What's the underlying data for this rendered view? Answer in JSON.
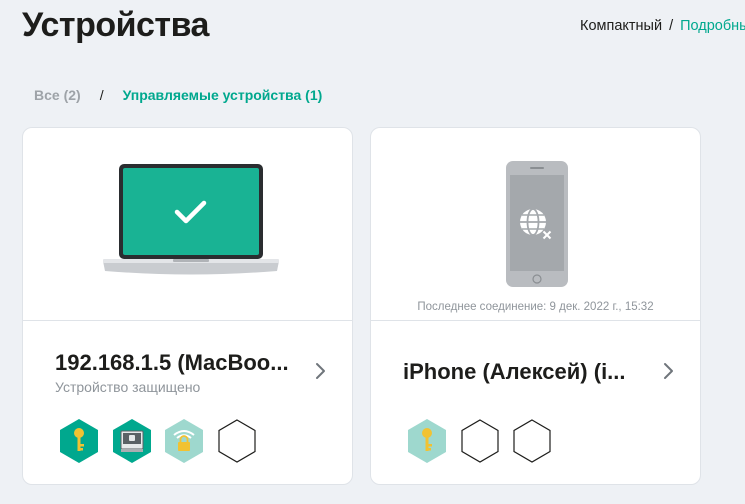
{
  "page": {
    "title": "Устройства"
  },
  "view_switch": {
    "compact": "Компактный",
    "separator": "/",
    "detailed": "Подробны"
  },
  "filters": {
    "all": "Все (2)",
    "separator": "/",
    "managed": "Управляемые устройства (1)"
  },
  "devices": [
    {
      "name": "192.168.1.5 (MacBoo...",
      "status": "Устройство защищено",
      "image": "laptop-protected",
      "badges": [
        "key-icon",
        "drive-icon",
        "wifi-lock-icon",
        "empty-hexagon-icon"
      ]
    },
    {
      "name": "iPhone (Алексей) (i...",
      "last_connection": "Последнее соединение:  9 дек. 2022 г., 15:32",
      "image": "phone-disconnected",
      "badges": [
        "key-icon",
        "empty-hexagon-icon",
        "empty-hexagon-icon"
      ]
    }
  ],
  "colors": {
    "accent": "#00a88e",
    "accent_light": "#9ed8ce",
    "background": "#eef1f5",
    "text_primary": "#1d1d1b",
    "text_muted": "#8f959b"
  }
}
